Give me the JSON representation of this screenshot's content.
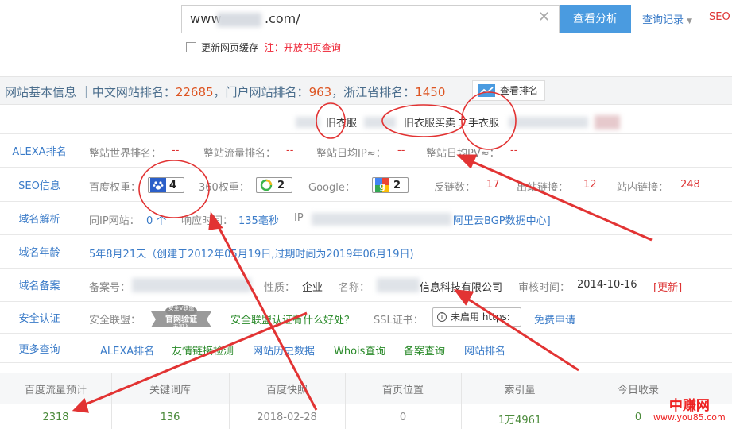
{
  "search": {
    "value_prefix": "www",
    "value_suffix": ".com/",
    "clear_icon": "close-icon",
    "button": "查看分析",
    "history": "查询记录",
    "seo": "SEO"
  },
  "cache": {
    "label": "更新网页缓存",
    "note_prefix": "注：",
    "note": "开放内页查询"
  },
  "basic": {
    "title": "网站基本信息",
    "sep": "｜",
    "cn_label": "中文网站排名：",
    "cn_rank": "22685",
    "portal_label": "，门户网站排名：",
    "portal_rank": "963",
    "province_label": "，浙江省排名：",
    "province_rank": "1450",
    "rank_btn": "查看排名"
  },
  "keywords": [
    "旧衣服",
    "旧衣服买卖",
    "二手衣服"
  ],
  "alexa": {
    "label": "ALEXA排名",
    "items": [
      {
        "k": "整站世界排名：",
        "v": "--"
      },
      {
        "k": "整站流量排名：",
        "v": "--"
      },
      {
        "k": "整站日均IP≈：",
        "v": "--"
      },
      {
        "k": "整站日均PV≈：",
        "v": "--"
      }
    ]
  },
  "seo": {
    "label": "SEO信息",
    "baidu_k": "百度权重：",
    "baidu_v": "4",
    "s360_k": "360权重：",
    "s360_v": "2",
    "google_k": "Google：",
    "google_v": "2",
    "back_k": "反链数：",
    "back_v": "17",
    "out_k": "出站链接：",
    "out_v": "12",
    "in_k": "站内链接：",
    "in_v": "248"
  },
  "resolve": {
    "label": "域名解析",
    "ip_k": "同IP网站：",
    "ip_v": "0 个",
    "resp_k": "响应时间：",
    "resp_v": "135毫秒",
    "ipaddr_k": "IP",
    "host": "阿里云BGP数据中心]"
  },
  "age": {
    "label": "域名年龄",
    "text": "5年8月21天（创建于2012年05月19日,过期时间为2019年06月19日)"
  },
  "icp": {
    "label": "域名备案",
    "no_k": "备案号：",
    "nature_k": "性质：",
    "nature_v": "企业",
    "name_k": "名称：",
    "name_v": "信息科技有限公司",
    "time_k": "审核时间：",
    "time_v": "2014-10-16",
    "update": "[更新]"
  },
  "security": {
    "label": "安全认证",
    "union_k": "安全联盟：",
    "seal_top": "安全V联盟",
    "seal_mid": "官网验证",
    "seal_bot": "未加入",
    "union_link": "安全联盟认证有什么好处？",
    "ssl_k": "SSL证书：",
    "ssl_btn": "未启用 https:",
    "apply": "免费申请"
  },
  "more": {
    "label": "更多查询",
    "links": [
      "ALEXA排名",
      "友情链接检测",
      "网站历史数据",
      "Whois查询",
      "备案查询",
      "网站排名"
    ]
  },
  "stats": {
    "headers": [
      "百度流量预计",
      "关键词库",
      "百度快照",
      "首页位置",
      "索引量",
      "今日收录"
    ],
    "values": [
      "2318",
      "136",
      "2018-02-28",
      "0",
      "1万4961",
      "0"
    ]
  },
  "watermark": {
    "cn": "中赚网",
    "url": "www.you85.com"
  },
  "colors": {
    "accent": "#4a9be0",
    "link": "#3a7bc8",
    "value": "#dd3333",
    "annotation": "#e23333"
  }
}
